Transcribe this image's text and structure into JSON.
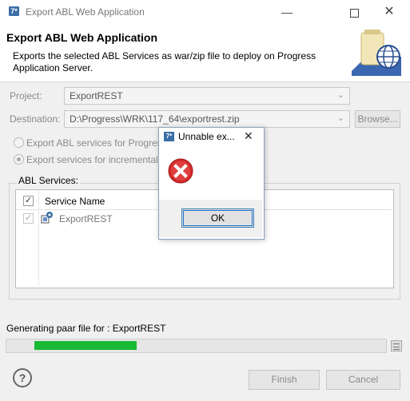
{
  "window": {
    "title": "Export ABL Web Application",
    "app_icon_glyph": "7*"
  },
  "header": {
    "title": "Export ABL Web Application",
    "description": "Exports the selected ABL Services as war/zip file to deploy on Progress Application Server."
  },
  "form": {
    "project_label": "Project:",
    "project_value": "ExportREST",
    "destination_label": "Destination:",
    "destination_value": "D:\\Progress\\WRK\\117_64\\exportrest.zip",
    "browse_label": "Browse...",
    "radio_full_label": "Export ABL services for Progress",
    "radio_incremental_label": "Export services for incremental",
    "radio_incremental_selected": true
  },
  "services": {
    "group_label": "ABL Services:",
    "column_header": "Service Name",
    "rows": [
      {
        "name": "ExportREST",
        "checked": true
      }
    ]
  },
  "progress": {
    "label": "Generating paar file for : ExportREST",
    "fraction_start": 0.074,
    "fraction_filled": 0.27,
    "color": "#18b935"
  },
  "footer": {
    "help_glyph": "?",
    "finish_label": "Finish",
    "cancel_label": "Cancel"
  },
  "dialog": {
    "title": "Unnable ex...",
    "close_glyph": "✕",
    "ok_label": "OK",
    "icon": "error-icon"
  }
}
